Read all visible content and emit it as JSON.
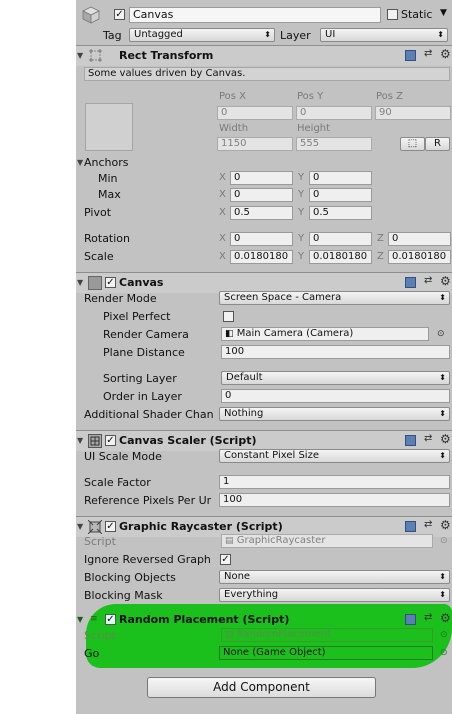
{
  "gameobject": {
    "name": "Canvas",
    "static_label": "Static",
    "tag_label": "Tag",
    "tag_value": "Untagged",
    "layer_label": "Layer",
    "layer_value": "UI"
  },
  "rect_transform": {
    "title": "Rect Transform",
    "note": "Some values driven by Canvas.",
    "pos_x_label": "Pos X",
    "pos_y_label": "Pos Y",
    "pos_z_label": "Pos Z",
    "pos_x": "0",
    "pos_y": "0",
    "pos_z": "90",
    "width_label": "Width",
    "height_label": "Height",
    "width": "1150",
    "height": "555",
    "r_button": "R",
    "anchors_label": "Anchors",
    "min_label": "Min",
    "max_label": "Max",
    "min_x": "0",
    "min_y": "0",
    "max_x": "0",
    "max_y": "0",
    "pivot_label": "Pivot",
    "pivot_x": "0.5",
    "pivot_y": "0.5",
    "rotation_label": "Rotation",
    "rot_x": "0",
    "rot_y": "0",
    "rot_z": "0",
    "scale_label": "Scale",
    "scale_x": "0.0180180",
    "scale_y": "0.0180180",
    "scale_z": "0.0180180",
    "x": "X",
    "y": "Y",
    "z": "Z"
  },
  "canvas": {
    "title": "Canvas",
    "render_mode_label": "Render Mode",
    "render_mode": "Screen Space - Camera",
    "pixel_perfect_label": "Pixel Perfect",
    "render_camera_label": "Render Camera",
    "render_camera": "Main Camera (Camera)",
    "plane_distance_label": "Plane Distance",
    "plane_distance": "100",
    "sorting_layer_label": "Sorting Layer",
    "sorting_layer": "Default",
    "order_label": "Order in Layer",
    "order": "0",
    "shader_label": "Additional Shader Chan",
    "shader": "Nothing"
  },
  "canvas_scaler": {
    "title": "Canvas Scaler (Script)",
    "ui_scale_label": "UI Scale Mode",
    "ui_scale": "Constant Pixel Size",
    "scale_factor_label": "Scale Factor",
    "scale_factor": "1",
    "ref_ppu_label": "Reference Pixels Per Ur",
    "ref_ppu": "100"
  },
  "raycaster": {
    "title": "Graphic Raycaster (Script)",
    "script_label": "Script",
    "script": "GraphicRaycaster",
    "ignore_label": "Ignore Reversed Graph",
    "blocking_objects_label": "Blocking Objects",
    "blocking_objects": "None",
    "blocking_mask_label": "Blocking Mask",
    "blocking_mask": "Everything"
  },
  "random_placement": {
    "title": "Random Placement (Script)",
    "script_label": "Script",
    "script": "RandomPlacement",
    "go_label": "Go",
    "go": "None (Game Object)"
  },
  "add_component": "Add Component",
  "colors": {
    "panel": "#c2c2c2",
    "header": "#cbcbcb",
    "highlight": "#18c01a"
  },
  "icons": [
    "gameobject-cube-icon",
    "rect-transform-icon",
    "canvas-icon",
    "canvas-scaler-icon",
    "raycaster-icon",
    "script-icon",
    "help-book-icon",
    "settings-gear-icon",
    "preset-icon",
    "object-picker-icon"
  ]
}
